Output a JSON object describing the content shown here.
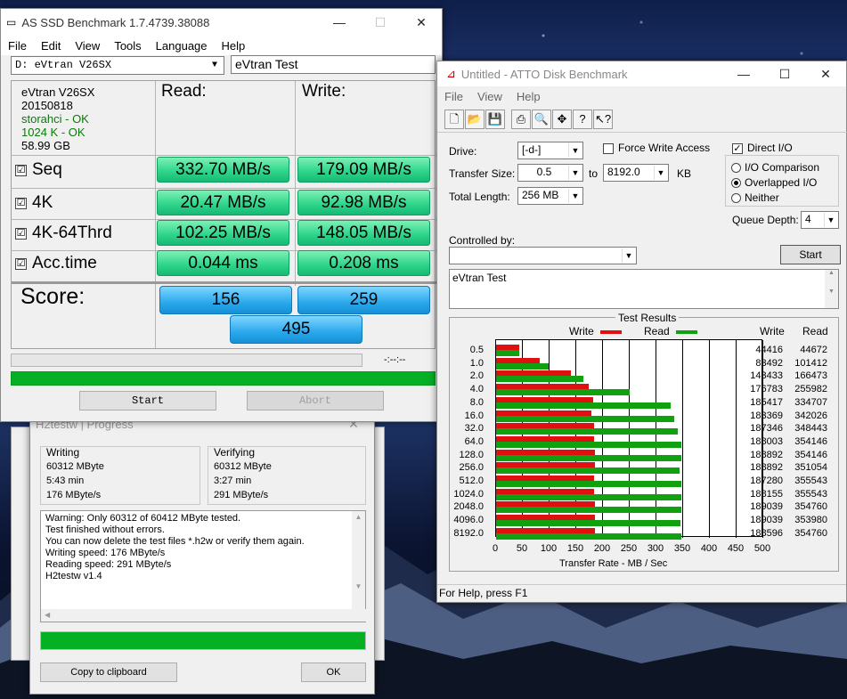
{
  "as_ssd": {
    "title": "AS SSD Benchmark 1.7.4739.38088",
    "menu": [
      "File",
      "Edit",
      "View",
      "Tools",
      "Language",
      "Help"
    ],
    "drive": "D: eVtran V26SX",
    "name_field": "eVtran Test",
    "info": {
      "model": "eVtran V26SX",
      "fw": "20150818",
      "driver": "storahci - OK",
      "align": "1024 K - OK",
      "size": "58.99 GB"
    },
    "read_label": "Read:",
    "write_label": "Write:",
    "rows": [
      {
        "label": "Seq",
        "read": "332.70 MB/s",
        "write": "179.09 MB/s"
      },
      {
        "label": "4K",
        "read": "20.47 MB/s",
        "write": "92.98 MB/s"
      },
      {
        "label": "4K-64Thrd",
        "read": "102.25 MB/s",
        "write": "148.05 MB/s"
      },
      {
        "label": "Acc.time",
        "read": "0.044 ms",
        "write": "0.208 ms"
      }
    ],
    "check": "☑",
    "score_label": "Score:",
    "score_read": "156",
    "score_write": "259",
    "score_total": "495",
    "time": "-:--:--",
    "start": "Start",
    "abort": "Abort"
  },
  "h2": {
    "title": "H2testw | Progress",
    "writing": {
      "cap": "Writing",
      "size": "60312 MByte",
      "time": "5:43 min",
      "speed": "176 MByte/s"
    },
    "verifying": {
      "cap": "Verifying",
      "size": "60312 MByte",
      "time": "3:27 min",
      "speed": "291 MByte/s"
    },
    "log": [
      "Warning: Only 60312 of 60412 MByte tested.",
      "Test finished without errors.",
      "You can now delete the test files *.h2w or verify them again.",
      "Writing speed: 176 MByte/s",
      "Reading speed: 291 MByte/s",
      "H2testw v1.4"
    ],
    "copy": "Copy to clipboard",
    "ok": "OK"
  },
  "atto": {
    "title": "Untitled - ATTO Disk Benchmark",
    "menu": [
      "File",
      "View",
      "Help"
    ],
    "drive_label": "Drive:",
    "drive": "[-d-]",
    "force_label": "Force Write Access",
    "direct_label": "Direct I/O",
    "ts_label": "Transfer Size:",
    "ts_from": "0.5",
    "to_label": "to",
    "ts_to": "8192.0",
    "kb": "KB",
    "tl_label": "Total Length:",
    "tl": "256 MB",
    "io_comp": "I/O Comparison",
    "io_over": "Overlapped I/O",
    "io_none": "Neither",
    "qd_label": "Queue Depth:",
    "qd": "4",
    "ctrl_label": "Controlled by:",
    "start": "Start",
    "desc": "eVtran Test",
    "results_title": "Test Results",
    "write_leg": "Write",
    "read_leg": "Read",
    "col_write": "Write",
    "col_read": "Read",
    "xlabel": "Transfer Rate - MB / Sec",
    "status": "For Help, press F1",
    "colors": {
      "write": "#e01010",
      "read": "#10a010"
    }
  },
  "chart_data": {
    "type": "bar",
    "categories": [
      "0.5",
      "1.0",
      "2.0",
      "4.0",
      "8.0",
      "16.0",
      "32.0",
      "64.0",
      "128.0",
      "256.0",
      "512.0",
      "1024.0",
      "2048.0",
      "4096.0",
      "8192.0"
    ],
    "series": [
      {
        "name": "Write",
        "values": [
          44416,
          83492,
          143433,
          176783,
          185417,
          183369,
          187346,
          188003,
          188892,
          188892,
          187280,
          188155,
          189039,
          189039,
          188596
        ]
      },
      {
        "name": "Read",
        "values": [
          44672,
          101412,
          166473,
          255982,
          334707,
          342026,
          348443,
          354146,
          354146,
          351054,
          355543,
          355543,
          354760,
          353980,
          354760
        ]
      }
    ],
    "xticks": [
      "0",
      "50",
      "100",
      "150",
      "200",
      "250",
      "300",
      "350",
      "400",
      "450",
      "500"
    ],
    "xlim": [
      0,
      500
    ],
    "xlabel": "Transfer Rate - MB / Sec",
    "legend": "top"
  }
}
